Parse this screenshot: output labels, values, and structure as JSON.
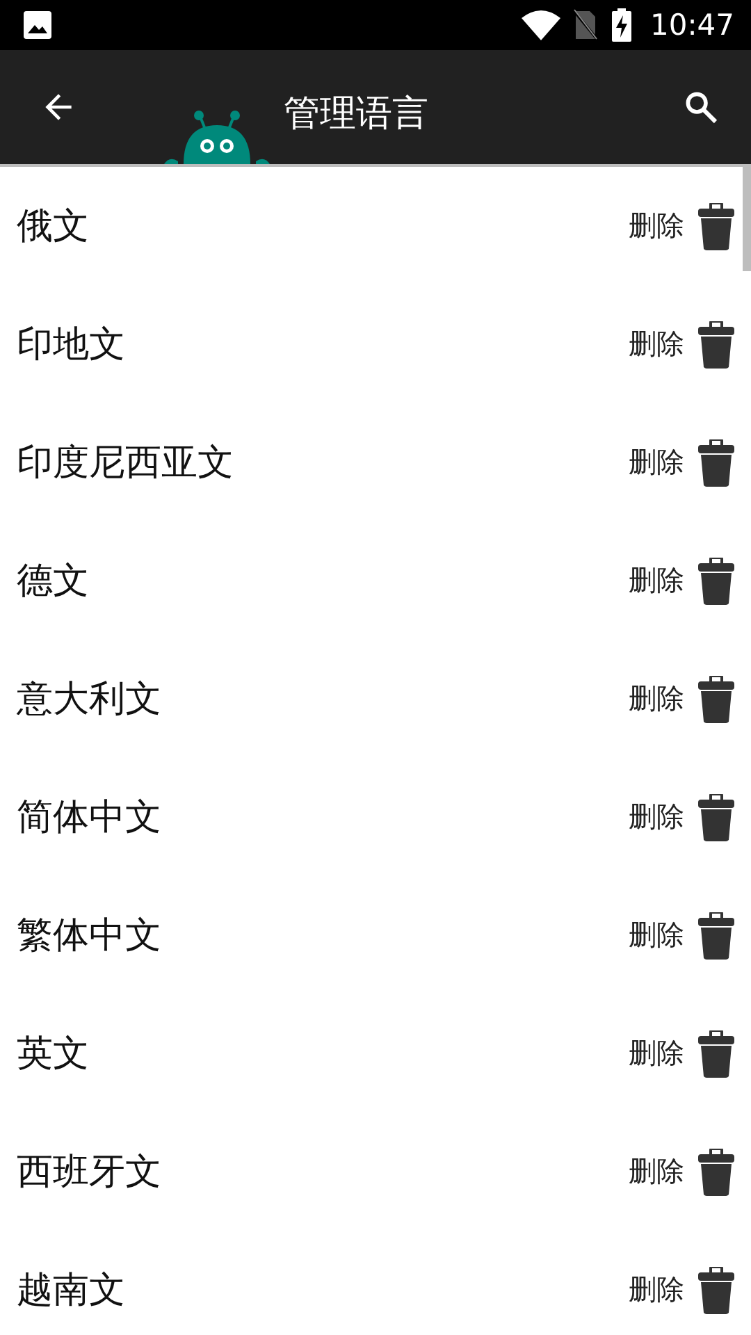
{
  "status_bar": {
    "time": "10:47"
  },
  "app_bar": {
    "title": "管理语言"
  },
  "languages": [
    {
      "name": "俄文",
      "action": "删除"
    },
    {
      "name": "印地文",
      "action": "删除"
    },
    {
      "name": "印度尼西亚文",
      "action": "删除"
    },
    {
      "name": "德文",
      "action": "删除"
    },
    {
      "name": "意大利文",
      "action": "删除"
    },
    {
      "name": "简体中文",
      "action": "删除"
    },
    {
      "name": "繁体中文",
      "action": "删除"
    },
    {
      "name": "英文",
      "action": "删除"
    },
    {
      "name": "西班牙文",
      "action": "删除"
    },
    {
      "name": "越南文",
      "action": "删除"
    }
  ]
}
